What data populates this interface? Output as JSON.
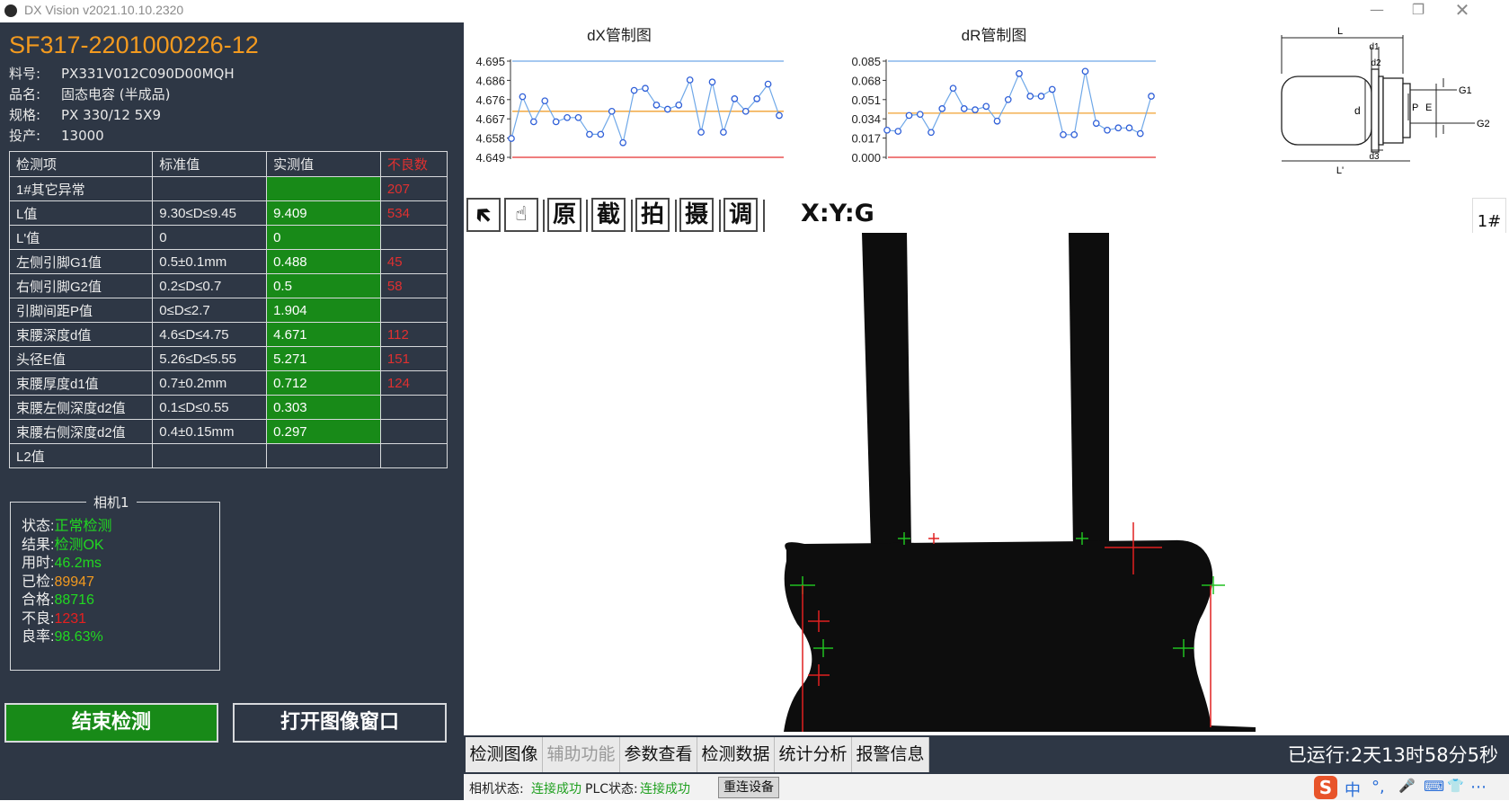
{
  "window": {
    "title": "DX Vision v2021.10.10.2320",
    "min_icon": "minimize-icon",
    "max_icon": "restore-icon",
    "close_icon": "close-icon"
  },
  "product": {
    "code": "SF317-2201000226-12",
    "fields": [
      {
        "label": "料号:",
        "value": "PX331V012C090D00MQH"
      },
      {
        "label": "品名:",
        "value": "固态电容 (半成品)"
      },
      {
        "label": "规格:",
        "value": "PX 330/12 5X9"
      },
      {
        "label": "投产:",
        "value": "13000"
      }
    ]
  },
  "spec_table": {
    "headers": [
      "检测项",
      "标准值",
      "实测值",
      "不良数"
    ],
    "rows": [
      {
        "item": "1#其它异常",
        "standard": "",
        "measured": "",
        "defects": "207",
        "measured_green": true
      },
      {
        "item": "L值",
        "standard": "9.30≤D≤9.45",
        "measured": "9.409",
        "defects": "534",
        "measured_green": true
      },
      {
        "item": "L'值",
        "standard": "0",
        "measured": "0",
        "defects": "",
        "measured_green": true
      },
      {
        "item": "左侧引脚G1值",
        "standard": "0.5±0.1mm",
        "measured": "0.488",
        "defects": "45",
        "measured_green": true
      },
      {
        "item": "右侧引脚G2值",
        "standard": "0.2≤D≤0.7",
        "measured": "0.5",
        "defects": "58",
        "measured_green": true
      },
      {
        "item": "引脚间距P值",
        "standard": "0≤D≤2.7",
        "measured": "1.904",
        "defects": "",
        "measured_green": true
      },
      {
        "item": "束腰深度d值",
        "standard": "4.6≤D≤4.75",
        "measured": "4.671",
        "defects": "112",
        "measured_green": true
      },
      {
        "item": "头径E值",
        "standard": "5.26≤D≤5.55",
        "measured": "5.271",
        "defects": "151",
        "measured_green": true
      },
      {
        "item": "束腰厚度d1值",
        "standard": "0.7±0.2mm",
        "measured": "0.712",
        "defects": "124",
        "measured_green": true
      },
      {
        "item": "束腰左侧深度d2值",
        "standard": "0.1≤D≤0.55",
        "measured": "0.303",
        "defects": "",
        "measured_green": true
      },
      {
        "item": "束腰右侧深度d2值",
        "standard": "0.4±0.15mm",
        "measured": "0.297",
        "defects": "",
        "measured_green": true
      },
      {
        "item": "L2值",
        "standard": "",
        "measured": "",
        "defects": "",
        "measured_green": false
      }
    ]
  },
  "camera": {
    "title": "相机1",
    "rows": [
      {
        "label": "状态:",
        "value": "正常检测",
        "color": "#21d821"
      },
      {
        "label": "结果:",
        "value": "检测OK",
        "color": "#21d821"
      },
      {
        "label": "用时:",
        "value": "46.2ms",
        "color": "#21d821"
      },
      {
        "label": "已检:",
        "value": "89947",
        "color": "#f39a1f"
      },
      {
        "label": "合格:",
        "value": "88716",
        "color": "#21d821"
      },
      {
        "label": "不良:",
        "value": "1231",
        "color": "#e52020"
      },
      {
        "label": "良率:",
        "value": "98.63%",
        "color": "#21d821"
      }
    ]
  },
  "buttons": {
    "stop": "结束检测",
    "open_image": "打开图像窗口"
  },
  "toolbar": {
    "pointer_icon": "arrow-pointer-icon",
    "hand_icon": "hand-icon",
    "original": "原",
    "crop": "截",
    "capture": "拍",
    "shoot": "摄",
    "adjust": "调",
    "coordinate": "X:Y:G"
  },
  "camera_index": "1#",
  "diagram": {
    "labels": [
      "L",
      "d1",
      "d2",
      "d",
      "P",
      "E",
      "G1",
      "G2",
      "d3",
      "L'"
    ]
  },
  "chart_data": [
    {
      "type": "line",
      "title": "dX管制图",
      "yticks": [
        "4.695",
        "4.686",
        "4.676",
        "4.667",
        "4.658",
        "4.649"
      ],
      "ylim": [
        4.649,
        4.695
      ],
      "upper_limit": 4.695,
      "lower_limit": 4.649,
      "center_line": 4.671,
      "limit_colors": {
        "upper": "#6fa8e8",
        "center": "#f0a030",
        "lower": "#e53030"
      },
      "series": [
        {
          "values": [
            4.658,
            4.678,
            4.666,
            4.676,
            4.666,
            4.668,
            4.668,
            4.66,
            4.66,
            4.671,
            4.656,
            4.681,
            4.682,
            4.674,
            4.672,
            4.674,
            4.686,
            4.661,
            4.685,
            4.661,
            4.677,
            4.671,
            4.677,
            4.684,
            4.669
          ]
        }
      ]
    },
    {
      "type": "line",
      "title": "dR管制图",
      "yticks": [
        "0.085",
        "0.068",
        "0.051",
        "0.034",
        "0.017",
        "0.000"
      ],
      "ylim": [
        0.0,
        0.085
      ],
      "upper_limit": 0.085,
      "lower_limit": 0.0,
      "center_line": 0.039,
      "limit_colors": {
        "upper": "#6fa8e8",
        "center": "#f0a030",
        "lower": "#e53030"
      },
      "series": [
        {
          "values": [
            0.024,
            0.023,
            0.037,
            0.038,
            0.022,
            0.043,
            0.061,
            0.043,
            0.042,
            0.045,
            0.032,
            0.051,
            0.074,
            0.054,
            0.054,
            0.06,
            0.02,
            0.02,
            0.076,
            0.03,
            0.024,
            0.026,
            0.026,
            0.021,
            0.054
          ]
        }
      ]
    }
  ],
  "tabs": [
    {
      "label": "检测图像",
      "disabled": false
    },
    {
      "label": "辅助功能",
      "disabled": true
    },
    {
      "label": "参数查看",
      "disabled": false
    },
    {
      "label": "检测数据",
      "disabled": false
    },
    {
      "label": "统计分析",
      "disabled": false
    },
    {
      "label": "报警信息",
      "disabled": false
    }
  ],
  "uptime": "已运行:2天13时58分5秒",
  "status": {
    "camera_label": "相机状态:",
    "camera_value": "连接成功",
    "plc_label": "PLC状态:",
    "plc_value": "连接成功",
    "reconnect": "重连设备"
  },
  "ime": {
    "logo": "S",
    "chars": [
      "中",
      "°,",
      "🎤",
      "⌨",
      "👕",
      "⋯"
    ]
  }
}
